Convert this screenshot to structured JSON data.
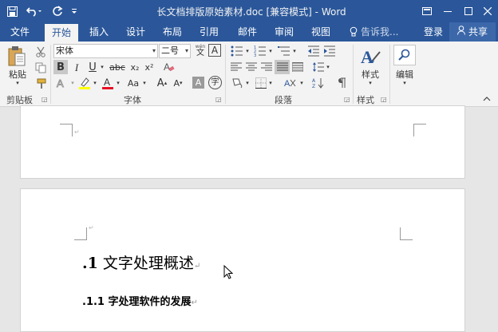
{
  "titlebar": {
    "title": "长文档排版原始素材.doc [兼容模式] - Word",
    "save_icon": "save-icon",
    "undo_icon": "undo-icon",
    "redo_icon": "redo-icon",
    "customize_icon": "customize-qat-icon",
    "ribbon_display_icon": "ribbon-display-options-icon",
    "minimize_icon": "minimize-icon",
    "maximize_icon": "maximize-icon",
    "close_icon": "close-icon"
  },
  "tabs": {
    "file": "文件",
    "home": "开始",
    "insert": "插入",
    "design": "设计",
    "layout": "布局",
    "references": "引用",
    "mailings": "邮件",
    "review": "审阅",
    "view": "视图",
    "tell_me": "告诉我...",
    "login": "登录",
    "share": "共享"
  },
  "ribbon": {
    "clipboard": {
      "paste": "粘贴",
      "group_label": "剪贴板"
    },
    "font": {
      "font_name": "宋体",
      "font_size": "二号",
      "wen_top": "wén",
      "wen_bottom": "文",
      "phonetic_A": "A",
      "bold": "B",
      "italic": "I",
      "underline": "U",
      "strike": "abc",
      "subscript": "x₂",
      "superscript": "x²",
      "aa_case": "Aa",
      "grow": "A",
      "shrink": "A",
      "char_shading": "A",
      "enclosed": "字",
      "group_label": "字体"
    },
    "paragraph": {
      "group_label": "段落"
    },
    "styles": {
      "styles_btn": "样式",
      "group_label": "样式"
    },
    "editing": {
      "editing_btn": "编辑"
    }
  },
  "document": {
    "heading1_num": ".1",
    "heading1_text": "文字处理概述",
    "heading2_num": ".1.1",
    "heading2_text": "字处理软件的发展",
    "paragraph_mark": "↵"
  },
  "colors": {
    "word_blue": "#2b579a",
    "highlight_yellow": "#ffff00",
    "font_red": "#e81123"
  }
}
